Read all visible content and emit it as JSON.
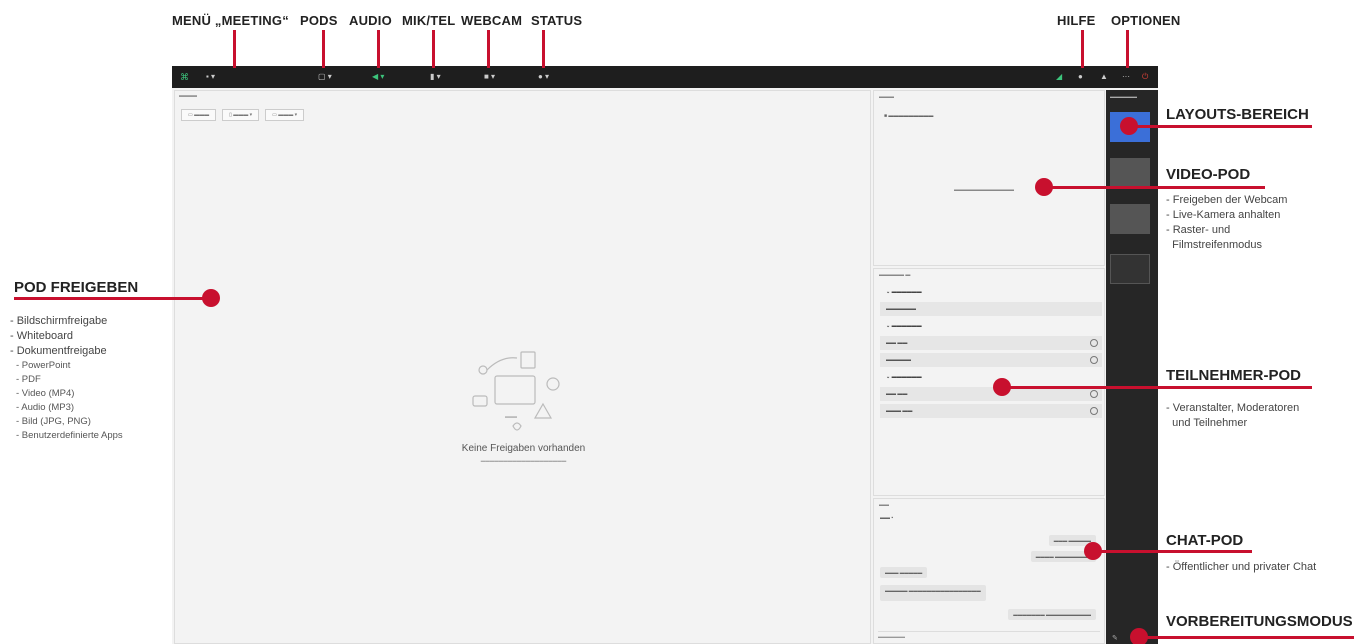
{
  "labels": {
    "menu_meeting": "MENÜ „MEETING“",
    "pods": "PODS",
    "audio": "AUDIO",
    "mik_tel": "MIK/TEL",
    "webcam": "WEBCAM",
    "status": "STATUS",
    "hilfe": "HILFE",
    "optionen": "OPTIONEN"
  },
  "callouts": {
    "pod_freigeben": {
      "title": "POD FREIGEBEN",
      "items": [
        "- Bildschirmfreigabe",
        "- Whiteboard",
        "- Dokumentfreigabe"
      ],
      "subitems": [
        "- PowerPoint",
        "- PDF",
        "- Video (MP4)",
        "- Audio (MP3)",
        "- Bild (JPG, PNG)",
        "- Benutzerdefinierte Apps"
      ]
    },
    "layouts": {
      "title": "LAYOUTS-BEREICH"
    },
    "video_pod": {
      "title": "VIDEO-POD",
      "items": [
        "- Freigeben der Webcam",
        "- Live-Kamera anhalten",
        "- Raster- und",
        "  Filmstreifenmodus"
      ]
    },
    "teilnehmer_pod": {
      "title": "TEILNEHMER-POD",
      "items": [
        "- Veranstalter, Moderatoren",
        "  und Teilnehmer"
      ]
    },
    "chat_pod": {
      "title": "CHAT-POD",
      "items": [
        "- Öffentlicher und privater Chat"
      ]
    },
    "vorbereitung": {
      "title": "VORBEREITUNGSMODUS"
    }
  },
  "app": {
    "share_pod": {
      "empty_message": "Keine Freigaben vorhanden"
    }
  },
  "colors": {
    "accent": "#c8102e",
    "topbar": "#1e1e1e",
    "rail": "#262626",
    "layout_selected": "#3b6fd8"
  }
}
